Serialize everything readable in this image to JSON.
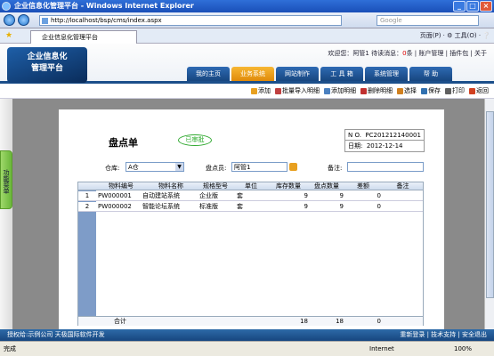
{
  "window": {
    "title": "企业信息化管理平台 - Windows Internet Explorer"
  },
  "address": {
    "url": "http://localhost/bsp/cms/index.aspx",
    "search_placeholder": "Google"
  },
  "tab": {
    "label": "企业信息化管理平台",
    "tools": "页面(P) · ⚙ 工具(O) · ❔"
  },
  "header": {
    "logo_line1": "企业信息化",
    "logo_line2": "管理平台",
    "welcome": "欢迎您：阿管1 待读消息：",
    "unread": "0",
    "unread_unit": "条",
    "links": "| 账户管理 | 插件包 | 关于"
  },
  "nav": [
    "我的主页",
    "业务系统",
    "网站制作",
    "工 具 箱",
    "系统管理",
    "帮  助"
  ],
  "toolbar": [
    "添加",
    "批量导入明细",
    "添加明细",
    "删除明细",
    "选择",
    "保存",
    "打印",
    "返回"
  ],
  "toolbar_colors": [
    "#e8a020",
    "#c04040",
    "#4a80c0",
    "#c03030",
    "#d08020",
    "#3070b0",
    "#606060",
    "#d04020"
  ],
  "sidebar": {
    "tab_label": "功能菜单"
  },
  "form": {
    "title": "盘点单",
    "status": "已审批",
    "no_label": "N O.",
    "no_value": "PC201212140001",
    "date_label": "日期:",
    "date_value": "2012-12-14",
    "warehouse_label": "仓库:",
    "warehouse_value": "A仓",
    "checker_label": "盘点员:",
    "checker_value": "阿管1",
    "remark_label": "备注:",
    "remark_value": ""
  },
  "table": {
    "headers": [
      "物料编号",
      "物料名称",
      "规格型号",
      "单位",
      "库存数量",
      "盘点数量",
      "差额",
      "备注"
    ],
    "rows": [
      {
        "idx": "1",
        "code": "PW000001",
        "name": "自动建站系统",
        "spec": "企业版",
        "unit": "套",
        "stock": "9",
        "count": "9",
        "diff": "0",
        "note": ""
      },
      {
        "idx": "2",
        "code": "PW000002",
        "name": "智能论坛系统",
        "spec": "标准版",
        "unit": "套",
        "stock": "9",
        "count": "9",
        "diff": "0",
        "note": ""
      }
    ],
    "footer": {
      "label": "合计",
      "stock": "18",
      "count": "18",
      "diff": "0"
    }
  },
  "appstatus": {
    "left": "授权给:示例公司  天极国际软件开发",
    "right": "重新登录 | 技术支持 | 安全退出"
  },
  "statusbar": {
    "left": "完成",
    "zone": "Internet",
    "zoom": "100%"
  }
}
